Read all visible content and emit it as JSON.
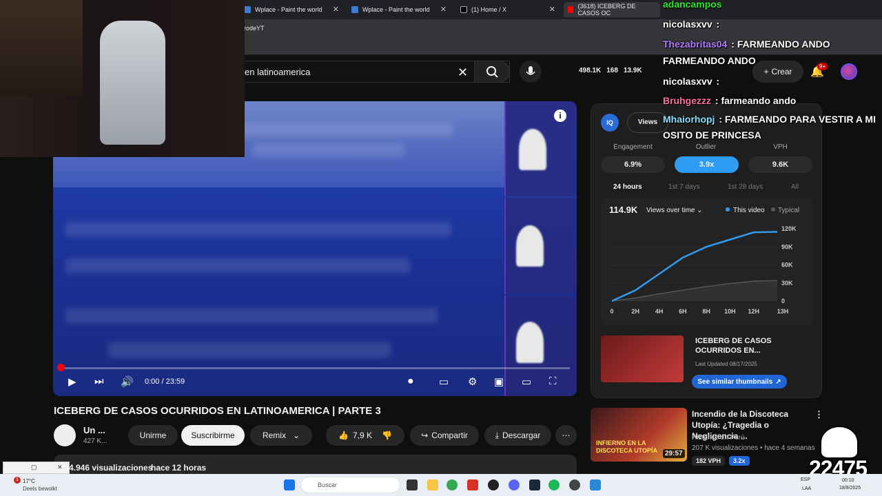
{
  "browser": {
    "tabs": [
      {
        "label": "Wplace - Paint the world"
      },
      {
        "label": "Wplace - Paint the world"
      },
      {
        "label": "(1) Home / X"
      },
      {
        "label": "(3618) ICEBERG DE CASOS OC"
      }
    ],
    "address_fragment": "rodeYT"
  },
  "youtube": {
    "search_query": "en latinoamerica",
    "stats": {
      "views": "498.1K",
      "likes": "168",
      "subs": "13.9K"
    },
    "create_label": "Crear",
    "notif_badge": "9+"
  },
  "player": {
    "time": "0:00 / 23:59",
    "info_label": "i",
    "progress": 0.0
  },
  "video": {
    "title": "ICEBERG DE CASOS OCURRIDOS EN LATINOAMERICA | PARTE 3",
    "channel_name": "Un ...",
    "channel_subs": "427 K...",
    "leave_label": "Unirme",
    "subscribe_label": "Suscribirme",
    "remix_label": "Remix",
    "likes": "7,9 K",
    "share_label": "Compartir",
    "download_label": "Descargar",
    "views_text": "4.946 visualizaciones",
    "age_text": "hace 12 horas"
  },
  "panel": {
    "logo": "IQ",
    "tab_label": "Views",
    "metrics": [
      {
        "label": "Engagement",
        "value": "6.9%"
      },
      {
        "label": "Outlier",
        "value": "3.9x"
      },
      {
        "label": "VPH",
        "value": "9.6K"
      }
    ],
    "ranges": [
      "24 hours",
      "1st 7 days",
      "1st 28 days",
      "All"
    ],
    "chart_header_value": "114.9K",
    "chart_header_select": "Views over time",
    "legend_this": "This video",
    "legend_typical": "Typical",
    "thumb_card": {
      "title": "ICEBERG DE CASOS OCURRIDOS EN...",
      "updated": "Last Updated 08/17/2025",
      "button": "See similar thumbnails"
    },
    "colors": {
      "accent": "#2f9cf4",
      "typical": "#555555"
    }
  },
  "chart_data": {
    "type": "line",
    "title": "",
    "xlabel": "",
    "ylabel": "",
    "x": [
      "0",
      "2H",
      "4H",
      "6H",
      "8H",
      "10H",
      "12H",
      "13H"
    ],
    "y_ticks": [
      "0",
      "30K",
      "60K",
      "90K",
      "120K"
    ],
    "ylim": [
      0,
      120000
    ],
    "series": [
      {
        "name": "This video",
        "values": [
          0,
          18000,
          45000,
          72000,
          90000,
          102000,
          114000,
          114900
        ]
      },
      {
        "name": "Typical",
        "values": [
          0,
          5000,
          12000,
          18000,
          24000,
          29000,
          33000,
          34000
        ]
      }
    ],
    "grid": true,
    "legend": "top-right"
  },
  "recommended": {
    "title": "Incendio de la Discoteca Utopía: ¿Tragedia o Negligencia ...",
    "channel": "Histórico en Perú",
    "meta": "207 K visualizaciones • hace 4 semanas",
    "duration": "29:57",
    "vph": "182 VPH",
    "outlier": "3.2x",
    "thumb_text": "INFIERNO EN LA DISCOTECA UTOPÍA"
  },
  "chat": [
    {
      "user": "adancampos",
      "color": "#2ee82e",
      "msg": ""
    },
    {
      "user": "nicolasxvv",
      "color": "#ffffff",
      "msg": ":"
    },
    {
      "user": "Thezabritas04",
      "color": "#b57bff",
      "msg": ": FARMEANDO ANDO"
    },
    {
      "user": "",
      "color": "#ffffff",
      "msg": "FARMEANDO ANDO"
    },
    {
      "user": "nicolasxvv",
      "color": "#ffffff",
      "msg": ":"
    },
    {
      "user": "Bruhgezzz",
      "color": "#ff6f9b",
      "msg": ": farmeando ando"
    },
    {
      "user": "Mhaiorhopj",
      "color": "#8be0ff",
      "msg": ": FARMEANDO PARA VESTIR A MI"
    },
    {
      "user": "",
      "color": "#ffffff",
      "msg": "OSITO DE PRINCESA"
    }
  ],
  "taskbar": {
    "weather_temp": "17°C",
    "weather_desc": "Deels bewolkt",
    "weather_badge": "1",
    "search_placeholder": "Buscar",
    "lang1": "ESP",
    "lang2": "LAA",
    "time": "00:10",
    "date": "18/8/2025"
  },
  "overlay_counter": "22475"
}
